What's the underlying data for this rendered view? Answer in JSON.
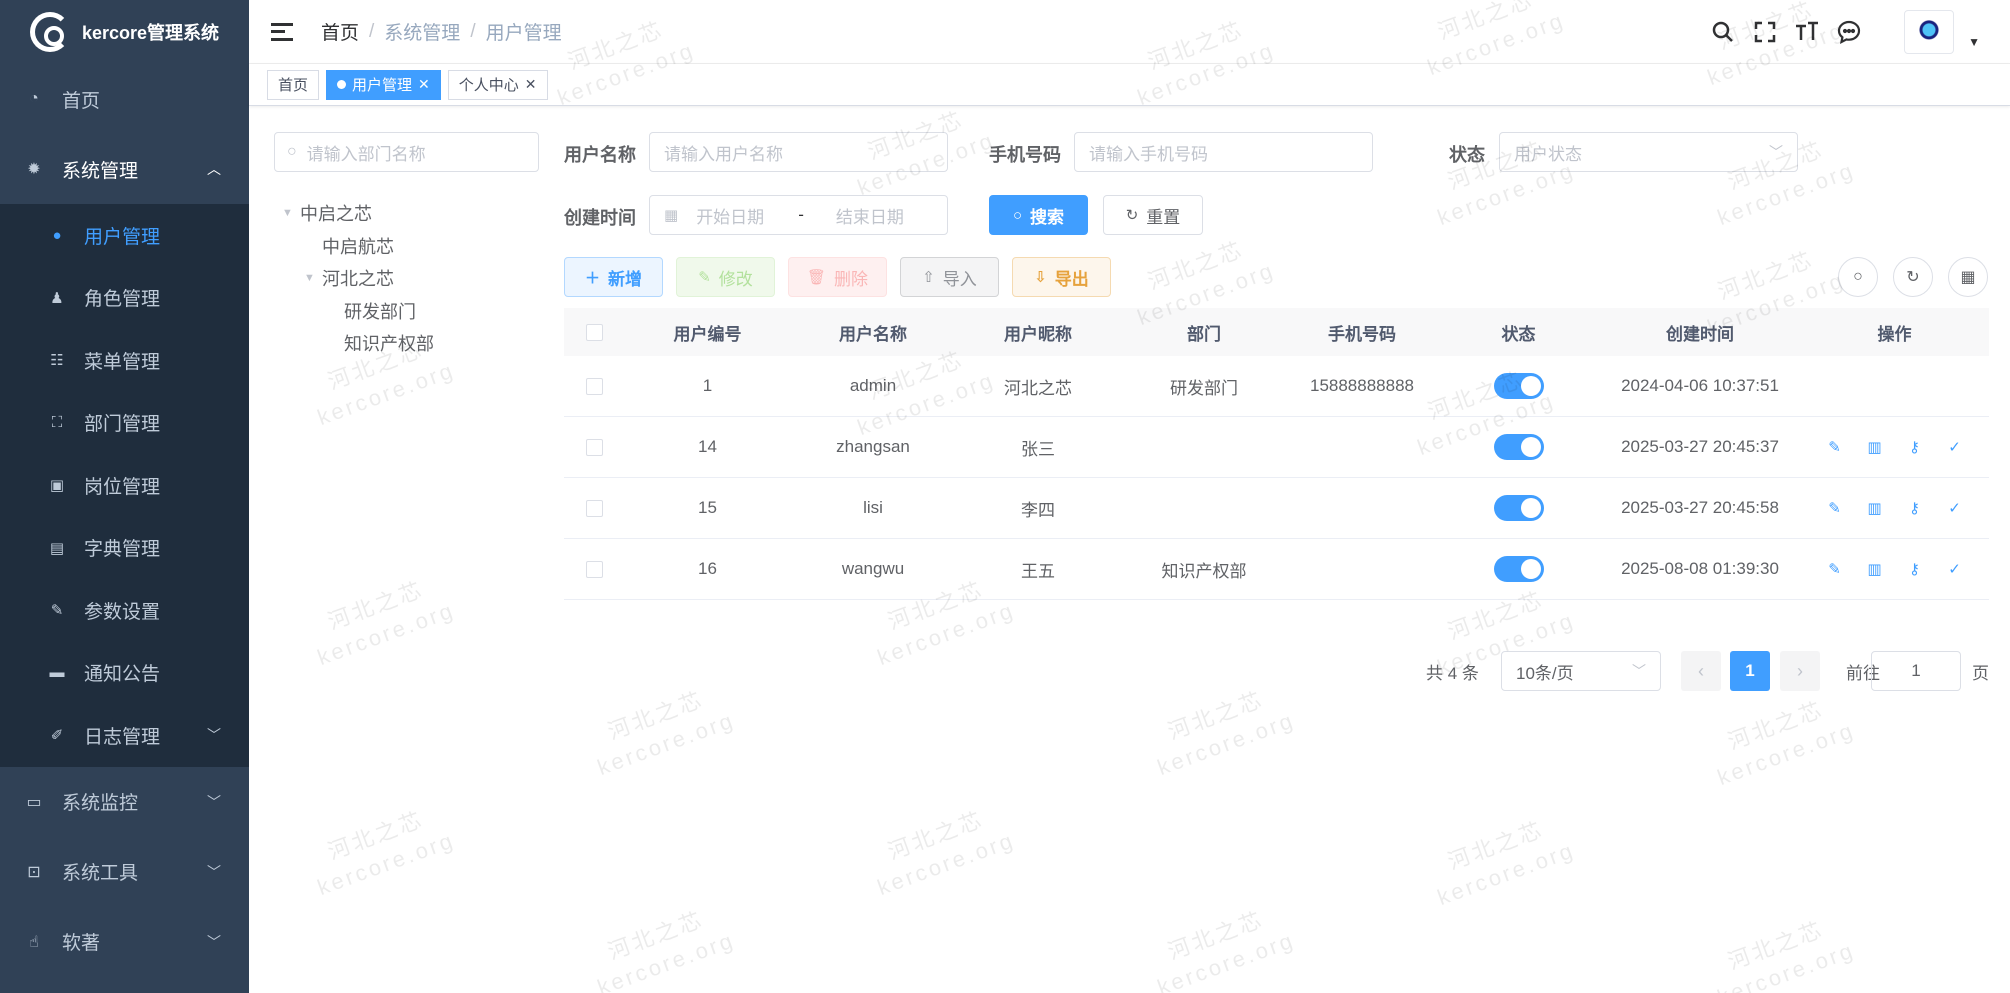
{
  "app": {
    "title": "kercore管理系统"
  },
  "sidebar": {
    "items": [
      {
        "label": "首页",
        "icon": "dashboard-icon"
      },
      {
        "label": "系统管理",
        "icon": "gear-icon",
        "open": true
      },
      {
        "label": "系统监控",
        "icon": "monitor-icon"
      },
      {
        "label": "系统工具",
        "icon": "toolbox-icon"
      },
      {
        "label": "软著",
        "icon": "hand-icon"
      }
    ],
    "submenu": [
      {
        "label": "用户管理",
        "icon": "user-icon",
        "active": true
      },
      {
        "label": "角色管理",
        "icon": "role-icon"
      },
      {
        "label": "菜单管理",
        "icon": "menu-tree-icon"
      },
      {
        "label": "部门管理",
        "icon": "org-chart-icon"
      },
      {
        "label": "岗位管理",
        "icon": "post-icon"
      },
      {
        "label": "字典管理",
        "icon": "dictionary-icon"
      },
      {
        "label": "参数设置",
        "icon": "edit-icon"
      },
      {
        "label": "通知公告",
        "icon": "message-icon"
      },
      {
        "label": "日志管理",
        "icon": "log-icon"
      }
    ]
  },
  "breadcrumb": [
    "首页",
    "系统管理",
    "用户管理"
  ],
  "tags": [
    {
      "label": "首页"
    },
    {
      "label": "用户管理",
      "active": true
    },
    {
      "label": "个人中心"
    }
  ],
  "dept": {
    "search_placeholder": "请输入部门名称",
    "tree": [
      {
        "label": "中启之芯",
        "level": 0,
        "expanded": true
      },
      {
        "label": "中启航芯",
        "level": 1
      },
      {
        "label": "河北之芯",
        "level": 1,
        "expanded": true
      },
      {
        "label": "研发部门",
        "level": 2
      },
      {
        "label": "知识产权部",
        "level": 2
      }
    ]
  },
  "form": {
    "username_label": "用户名称",
    "username_placeholder": "请输入用户名称",
    "phone_label": "手机号码",
    "phone_placeholder": "请输入手机号码",
    "status_label": "状态",
    "status_placeholder": "用户状态",
    "created_label": "创建时间",
    "start_placeholder": "开始日期",
    "range_sep": "-",
    "end_placeholder": "结束日期",
    "search_btn": "搜索",
    "reset_btn": "重置"
  },
  "toolbar": {
    "add": "新增",
    "edit": "修改",
    "delete": "删除",
    "import": "导入",
    "export": "导出"
  },
  "table": {
    "headers": [
      "用户编号",
      "用户名称",
      "用户昵称",
      "部门",
      "手机号码",
      "状态",
      "创建时间",
      "操作"
    ],
    "rows": [
      {
        "id": "1",
        "username": "admin",
        "nickname": "河北之芯",
        "dept": "研发部门",
        "phone": "15888888888",
        "status": true,
        "created": "2024-04-06 10:37:51",
        "actions": false
      },
      {
        "id": "14",
        "username": "zhangsan",
        "nickname": "张三",
        "dept": "",
        "phone": "",
        "status": true,
        "created": "2025-03-27 20:45:37",
        "actions": true
      },
      {
        "id": "15",
        "username": "lisi",
        "nickname": "李四",
        "dept": "",
        "phone": "",
        "status": true,
        "created": "2025-03-27 20:45:58",
        "actions": true
      },
      {
        "id": "16",
        "username": "wangwu",
        "nickname": "王五",
        "dept": "知识产权部",
        "phone": "",
        "status": true,
        "created": "2025-08-08 01:39:30",
        "actions": true
      }
    ]
  },
  "pagination": {
    "total": "共 4 条",
    "page_size": "10条/页",
    "current": "1",
    "goto_label": "前往",
    "goto_value": "1",
    "page_suffix": "页"
  },
  "watermark": {
    "line1": "河北之芯",
    "line2": "kercore.org"
  },
  "colors": {
    "primary": "#409eff",
    "sidebar_bg": "#304156",
    "submenu_bg": "#1f2d3d"
  }
}
